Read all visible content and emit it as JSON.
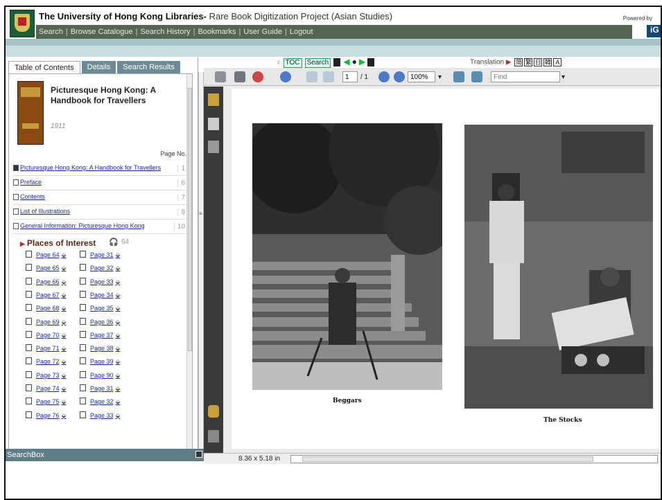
{
  "header": {
    "title_main": "The University of Hong Kong Libraries-",
    "title_rest": " Rare Book Digitization Project (Asian Studies)",
    "powered_by": "Powered by",
    "vendor": "iG"
  },
  "nav": [
    "Search",
    "Browse Catalogue",
    "Search History",
    "Bookmarks",
    "User Guide",
    "Logout"
  ],
  "left_panel": {
    "tabs": [
      "Table of Contents",
      "Details",
      "Search Results"
    ],
    "book_title": "Picturesque Hong Kong: A Handbook for Travellers",
    "book_year": "1911",
    "page_no_header": "Page No.",
    "toc": [
      {
        "label": "Picturesque Hong Kong: A Handbook for Travellers",
        "page": "1"
      },
      {
        "label": "Preface",
        "page": "6"
      },
      {
        "label": "Contents",
        "page": "7"
      },
      {
        "label": "List of Illustrations",
        "page": "8"
      },
      {
        "label": "General Information: Picturesque Hong Kong",
        "page": "10"
      }
    ],
    "section": {
      "label": "Places of Interest",
      "page": "64"
    },
    "pages_left": [
      "Page 64",
      "Page 65",
      "Page 66",
      "Page 67",
      "Page 68",
      "Page 69",
      "Page 70",
      "Page 71",
      "Page 72",
      "Page 73",
      "Page 74",
      "Page 75",
      "Page 76"
    ],
    "pages_right": [
      "Page 31",
      "Page 32",
      "Page 33",
      "Page 34",
      "Page 35",
      "Page 36",
      "Page 37",
      "Page 38",
      "Page 39",
      "Page 90",
      "Page 31",
      "Page 32",
      "Page 33"
    ],
    "searchbox_label": "SearchBox"
  },
  "viewer_nav": {
    "toc_btn": "TOC",
    "search_btn": "Search",
    "translation_label": "Translation",
    "translation_buttons": [
      "简",
      "繁",
      "日",
      "韓",
      "A"
    ]
  },
  "pdf_toolbar": {
    "page_value": "1",
    "page_total": "/ 1",
    "zoom_value": "100%",
    "find_placeholder": "Find"
  },
  "page_content": {
    "caption_left": "Beggars",
    "caption_right": "The Stocks"
  },
  "statusbar": {
    "dimensions": "8.36 x 5.18 in"
  },
  "colors": {
    "nav_bg": "#556650",
    "strip": "#a6c3c8",
    "tab_inactive": "#6c8c95",
    "link": "#1a2a9a"
  }
}
